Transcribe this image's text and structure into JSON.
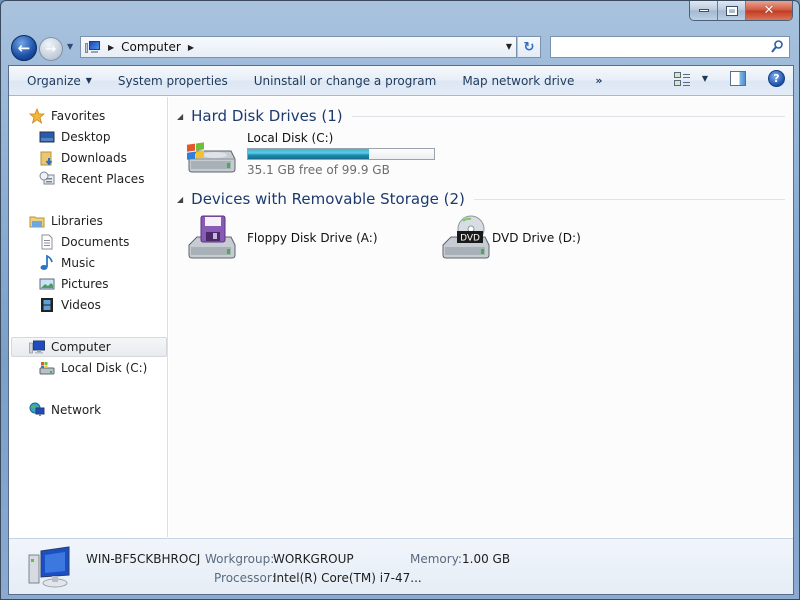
{
  "window": {
    "controls": {
      "minimize": "minimize",
      "maximize": "maximize",
      "close": "close"
    }
  },
  "navigation": {
    "back_glyph": "←",
    "forward_glyph": "→",
    "history_dropdown_glyph": "▼",
    "breadcrumb": [
      {
        "label": "Computer"
      }
    ],
    "breadcrumb_separator": "▶",
    "address_dropdown_glyph": "▼",
    "refresh_glyph": "↻",
    "search": {
      "value": "",
      "placeholder": ""
    }
  },
  "toolbar": {
    "organize": "Organize",
    "organize_caret": "▼",
    "system_properties": "System properties",
    "uninstall": "Uninstall or change a program",
    "map_network_drive": "Map network drive",
    "more": "»",
    "views_caret": "▼",
    "help_glyph": "?"
  },
  "sidebar": {
    "favorites": {
      "label": "Favorites",
      "items": [
        {
          "label": "Desktop"
        },
        {
          "label": "Downloads"
        },
        {
          "label": "Recent Places"
        }
      ]
    },
    "libraries": {
      "label": "Libraries",
      "items": [
        {
          "label": "Documents"
        },
        {
          "label": "Music"
        },
        {
          "label": "Pictures"
        },
        {
          "label": "Videos"
        }
      ]
    },
    "computer": {
      "label": "Computer",
      "selected": true,
      "items": [
        {
          "label": "Local Disk (C:)"
        }
      ]
    },
    "network": {
      "label": "Network"
    }
  },
  "content": {
    "groups": [
      {
        "title": "Hard Disk Drives (1)",
        "items": [
          {
            "name": "Local Disk (C:)",
            "free_text": "35.1 GB free of 99.9 GB",
            "used_fraction": 0.649,
            "icon": "windows-hard-disk-icon"
          }
        ]
      },
      {
        "title": "Devices with Removable Storage (2)",
        "items": [
          {
            "name": "Floppy Disk Drive (A:)",
            "icon": "floppy-drive-icon"
          },
          {
            "name": "DVD Drive (D:)",
            "icon": "dvd-drive-icon",
            "badge": "DVD"
          }
        ]
      }
    ],
    "collapse_glyph": "◢"
  },
  "details": {
    "computer_name": "WIN-BF5CKBHROCJ",
    "workgroup_label": "Workgroup:",
    "workgroup_value": "WORKGROUP",
    "memory_label": "Memory:",
    "memory_value": "1.00 GB",
    "processor_label": "Processor:",
    "processor_value": "Intel(R) Core(TM) i7-47..."
  },
  "colors": {
    "accent_title": "#1d3a6e",
    "disk_bar": "#26a0c4",
    "close_button": "#c7472c"
  }
}
